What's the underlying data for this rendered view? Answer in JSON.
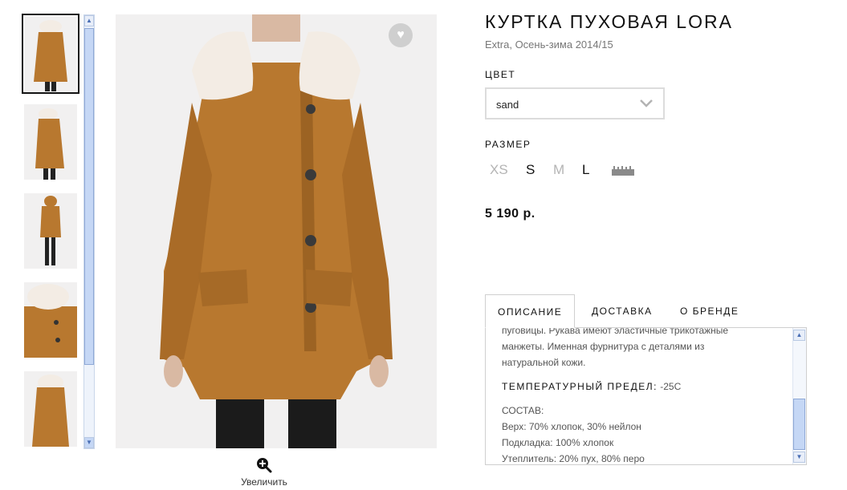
{
  "product": {
    "title": "КУРТКА ПУХОВАЯ LORA",
    "subtitle": "Extra, Осень-зима 2014/15",
    "color_label": "ЦВЕТ",
    "color_value": "sand",
    "size_label": "РАЗМЕР",
    "sizes": [
      {
        "label": "XS",
        "available": false
      },
      {
        "label": "S",
        "available": true
      },
      {
        "label": "M",
        "available": false
      },
      {
        "label": "L",
        "available": true
      }
    ],
    "price": "5 190 р."
  },
  "gallery": {
    "zoom_label": "Увеличить",
    "thumbnail_count": 5,
    "selected_index": 0
  },
  "tabs": [
    {
      "label": "ОПИСАНИЕ",
      "active": true
    },
    {
      "label": "ДОСТАВКА",
      "active": false
    },
    {
      "label": "О БРЕНДЕ",
      "active": false
    }
  ],
  "description": {
    "lines": [
      "пуговицы. Рукава имеют эластичные трикотажные",
      "манжеты. Именная фурнитура с деталями из",
      "натуральной кожи."
    ],
    "temp_label": "ТЕМПЕРАТУРНЫЙ ПРЕДЕЛ:",
    "temp_value": "-25C",
    "composition_title": "СОСТАВ:",
    "composition": [
      "Верх: 70% хлопок, 30% нейлон",
      "Подкладка: 100% хлопок",
      "Утеплитель: 20% пух, 80% перо"
    ]
  },
  "icons": {
    "favorite": "heart-icon",
    "zoom": "zoom-in-icon",
    "dropdown": "chevron-down-icon",
    "size_chart": "ruler-icon"
  },
  "colors": {
    "coat": "#b8782f",
    "fur": "#f3ece4",
    "background": "#f1f0f0",
    "scrollbar": "#c5d7f5"
  }
}
